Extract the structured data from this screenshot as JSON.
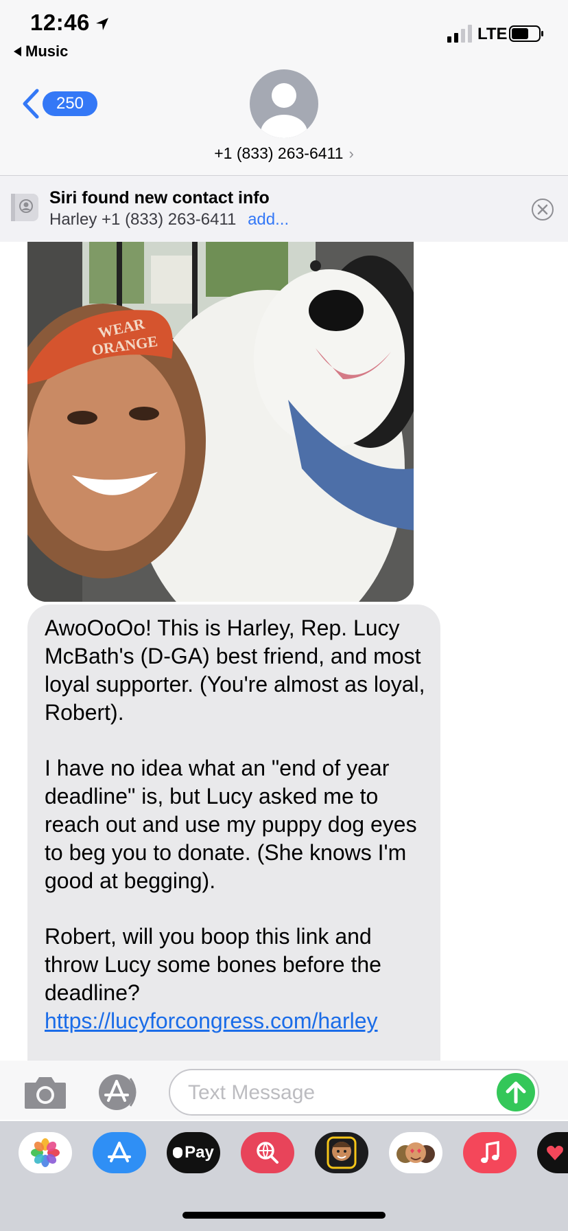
{
  "status_bar": {
    "time": "12:46",
    "back_app": "Music",
    "network": "LTE"
  },
  "header": {
    "unread_count": "250",
    "contact_number": "+1 (833) 263-6411"
  },
  "siri_banner": {
    "title": "Siri found new contact info",
    "name": "Harley",
    "number": "+1 (833) 263-6411",
    "action": "add..."
  },
  "photo": {
    "cap_text_line1": "WEAR",
    "cap_text_line2": "ORANGE"
  },
  "message": {
    "paragraph1": "AwoOoOo! This is Harley, Rep. Lucy McBath's (D-GA) best friend, and most loyal supporter. (You're almost as loyal, Robert).",
    "paragraph2": "I have no idea what an \"end of year deadline\" is, but Lucy asked me to reach out and use my puppy dog eyes to beg you to donate. (She knows I'm good at begging).",
    "paragraph3_text": "Robert, will you boop this link and throw Lucy some bones before the deadline?",
    "link": "https://lucyforcongress.com/harley"
  },
  "compose": {
    "placeholder": "Text Message"
  },
  "app_drawer": {
    "apps": [
      "Photos",
      "App Store",
      "Apple Pay",
      "Search Images",
      "Memoji",
      "Memoji Stickers",
      "Music",
      "Digital Touch"
    ],
    "apple_pay_label": "Pay"
  },
  "colors": {
    "accent_blue": "#3478f6",
    "send_green": "#34c759",
    "bubble_gray": "#e9e9eb",
    "music_red": "#f4475a"
  }
}
